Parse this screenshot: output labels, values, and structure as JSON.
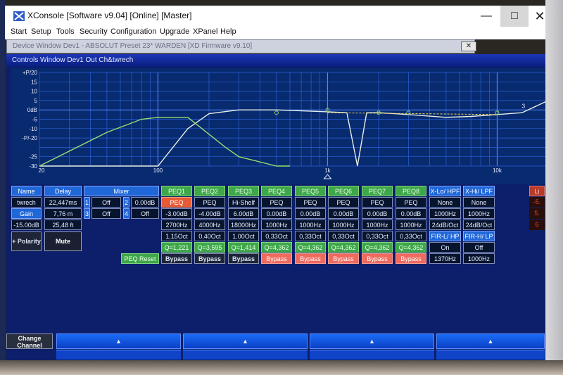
{
  "window": {
    "title": "XConsole [Software v9.04] [Online] [Master]",
    "minimize": "—",
    "maximize": "□",
    "close": "✕"
  },
  "menu": [
    "Start",
    "Setup",
    "Tools",
    "Security",
    "Configuration",
    "Upgrade",
    "XPanel",
    "Help"
  ],
  "device_window": {
    "title": "Device Window Dev1 - ABSOLUT  Preset 23* WARDEN [XD Firmware v9.10]",
    "close": "✕"
  },
  "controls_window": {
    "title": "Controls Window Dev1 Out Ch&twrech"
  },
  "graph": {
    "y_labels": [
      "+P/20",
      "15",
      "10",
      "5",
      "0dB",
      "-5",
      "-10",
      "-P/-20",
      "-25",
      "-30"
    ],
    "x_labels": [
      "20",
      "100",
      "1k",
      "10k"
    ],
    "marker_3": "3"
  },
  "chart_data": {
    "type": "line",
    "title": "",
    "xlabel": "",
    "ylabel": "",
    "x_scale": "log",
    "xlim": [
      20,
      20000
    ],
    "ylim": [
      -30,
      20
    ],
    "grid": true,
    "series": [
      {
        "color": "#e6efe6",
        "x": [
          20,
          100,
          150,
          200,
          300,
          500,
          1000,
          1300,
          1500,
          1700,
          2000,
          3000,
          5000,
          7000,
          10000,
          14000,
          20000
        ],
        "y": [
          -30,
          -30,
          -10,
          -2,
          0,
          0,
          -1,
          -1.5,
          -30,
          -1.5,
          -1.5,
          -2.5,
          -4,
          -3.5,
          -2.5,
          -1.5,
          5
        ]
      },
      {
        "color": "#96e06e",
        "x": [
          20,
          50,
          80,
          100,
          150,
          250,
          300,
          500,
          600
        ],
        "y": [
          -30,
          -12,
          -5,
          -4,
          -4,
          -20,
          -25,
          -30,
          -30
        ]
      },
      {
        "color": "#f0d45a",
        "x": [
          1000,
          10000
        ],
        "y": [
          -1.5,
          -2.5
        ]
      }
    ]
  },
  "left_panel": {
    "name_label": "Name",
    "delay_label": "Delay",
    "name_value": "twrech",
    "delay_ms": "22,447ms",
    "gain_label": "Gain",
    "delay_m": "7,76 m",
    "gain_value": "-15.00dB",
    "delay_ft": "25,48 ft",
    "polarity": "+ Polarity",
    "mute": "Mute"
  },
  "mixer": {
    "label": "Mixer",
    "rows": [
      [
        {
          "ch": "1",
          "val": "Off"
        },
        {
          "ch": "2",
          "val": "0.00dB"
        }
      ],
      [
        {
          "ch": "3",
          "val": "Off"
        },
        {
          "ch": "4",
          "val": "Off"
        }
      ]
    ]
  },
  "peq_reset": "PEQ Reset",
  "peq": [
    {
      "name": "PEQ1",
      "type": "PEQ",
      "gain": "-3.00dB",
      "freq": "2700Hz",
      "bw": "1,15Oct",
      "q": "Q=1,221",
      "bypass": "Bypass"
    },
    {
      "name": "PEQ2",
      "type": "PEQ",
      "gain": "-4.00dB",
      "freq": "4000Hz",
      "bw": "0,40Oct",
      "q": "Q=3,595",
      "bypass": "Bypass"
    },
    {
      "name": "PEQ3",
      "type": "Hi-Shelf",
      "gain": "6.00dB",
      "freq": "18000Hz",
      "bw": "1.00Oct",
      "q": "Q=1,414",
      "bypass": "Bypass"
    },
    {
      "name": "PEQ4",
      "type": "PEQ",
      "gain": "0.00dB",
      "freq": "1000Hz",
      "bw": "0,33Oct",
      "q": "Q=4,362",
      "bypass": "Bypass"
    },
    {
      "name": "PEQ5",
      "type": "PEQ",
      "gain": "0.00dB",
      "freq": "1000Hz",
      "bw": "0,33Oct",
      "q": "Q=4,362",
      "bypass": "Bypass"
    },
    {
      "name": "PEQ6",
      "type": "PEQ",
      "gain": "0.00dB",
      "freq": "1000Hz",
      "bw": "0,33Oct",
      "q": "Q=4,362",
      "bypass": "Bypass"
    },
    {
      "name": "PEQ7",
      "type": "PEQ",
      "gain": "0.00dB",
      "freq": "1000Hz",
      "bw": "0,33Oct",
      "q": "Q=4,362",
      "bypass": "Bypass"
    },
    {
      "name": "PEQ8",
      "type": "PEQ",
      "gain": "0.00dB",
      "freq": "1000Hz",
      "bw": "0,33Oct",
      "q": "Q=4,362",
      "bypass": "Bypass"
    }
  ],
  "xover": [
    {
      "header": "X-Lo/ HPF",
      "type": "None",
      "freq": "1000Hz",
      "slope": "24dB/Oct",
      "filter": "FIR-L/ HP",
      "state": "On",
      "freq2": "1370Hz"
    },
    {
      "header": "X-Hi/ LPF",
      "type": "None",
      "freq": "1000Hz",
      "slope": "24dB/Oct",
      "filter": "FIR-H/ LP",
      "state": "Off",
      "freq2": "1000Hz"
    }
  ],
  "right_slivers": [
    "Li",
    "-5.",
    "5.",
    "6"
  ],
  "bottom": {
    "change_channel": "Change Channel",
    "arrow": "▲"
  },
  "colors": {
    "accent_blue": "#2067d8",
    "peq_green": "#3fa74a",
    "active_orange": "#e85a35",
    "bypass_salmon": "#f06a5e",
    "graph_bg": "#082a6f"
  }
}
